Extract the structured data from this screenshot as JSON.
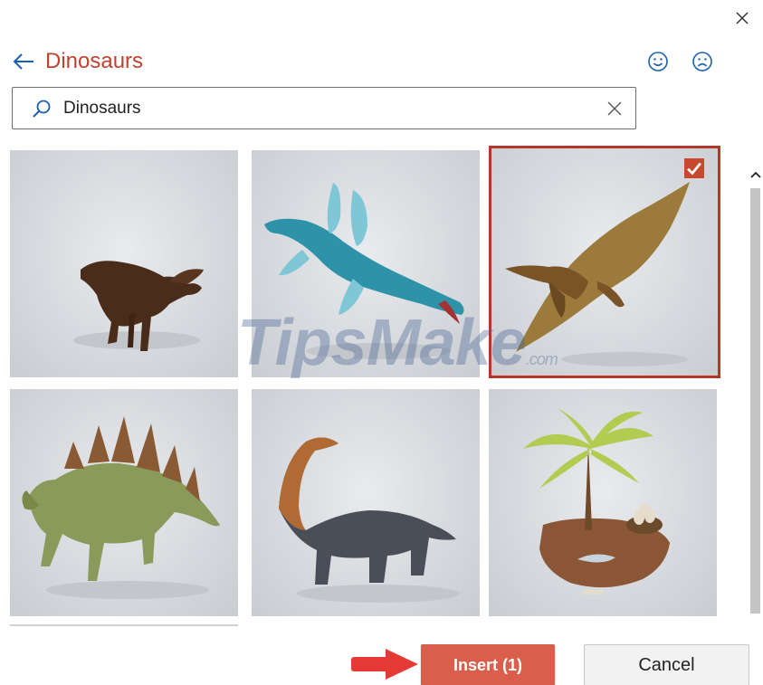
{
  "header": {
    "title": "Dinosaurs",
    "back_icon": "arrow-left-icon",
    "close_icon": "close-icon",
    "smile_icon": "smile-face-icon",
    "frown_icon": "frown-face-icon"
  },
  "search": {
    "value": "Dinosaurs",
    "icon": "search-icon",
    "clear_icon": "clear-icon"
  },
  "results": {
    "items": [
      {
        "subject": "parasaurolophus",
        "selected": false
      },
      {
        "subject": "plesiosaur",
        "selected": false
      },
      {
        "subject": "pterodactyl",
        "selected": true
      },
      {
        "subject": "stegosaurus",
        "selected": false
      },
      {
        "subject": "brachiosaurus",
        "selected": false
      },
      {
        "subject": "nest-island",
        "selected": false
      }
    ]
  },
  "watermark": {
    "text": "TipsMake",
    "suffix": ".com"
  },
  "footer": {
    "insert_label": "Insert (1)",
    "cancel_label": "Cancel"
  },
  "colors": {
    "accent": "#c0432f",
    "insert_button": "#d95f4c",
    "selection_border": "#b5372a",
    "pointer_arrow": "#e53935"
  }
}
